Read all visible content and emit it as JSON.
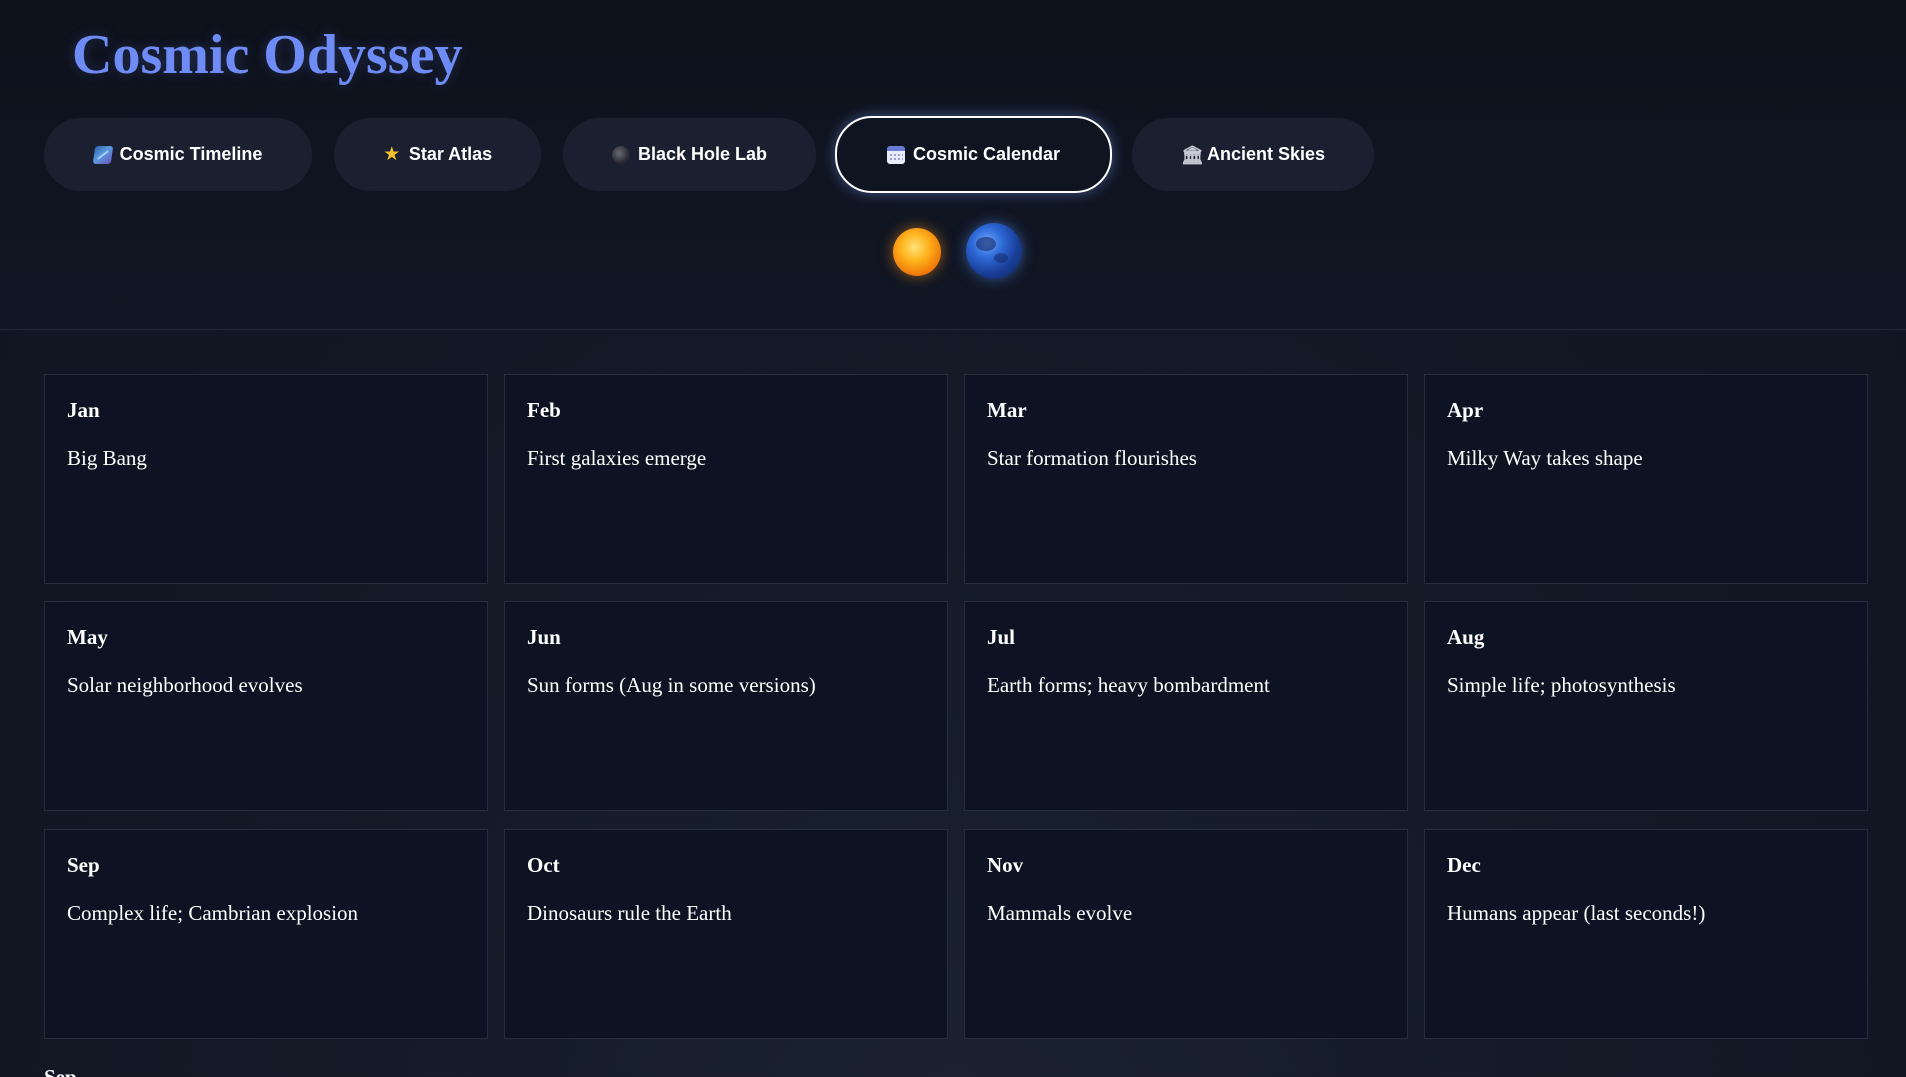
{
  "app": {
    "title": "Cosmic Odyssey"
  },
  "tabs": [
    {
      "label": "Cosmic Timeline",
      "icon": "timeline-icon"
    },
    {
      "label": "Star Atlas",
      "icon": "star-icon"
    },
    {
      "label": "Black Hole Lab",
      "icon": "black-hole-icon"
    },
    {
      "label": "Cosmic Calendar",
      "icon": "calendar-icon",
      "active": true
    },
    {
      "label": "Ancient Skies",
      "icon": "temple-icon"
    }
  ],
  "theme_toggles": [
    {
      "icon": "sun-icon"
    },
    {
      "icon": "earth-icon"
    }
  ],
  "calendar": {
    "months": [
      {
        "month": "Jan",
        "event": "Big Bang"
      },
      {
        "month": "Feb",
        "event": "First galaxies emerge"
      },
      {
        "month": "Mar",
        "event": "Star formation flourishes"
      },
      {
        "month": "Apr",
        "event": "Milky Way takes shape"
      },
      {
        "month": "May",
        "event": "Solar neighborhood evolves"
      },
      {
        "month": "Jun",
        "event": "Sun forms (Aug in some versions)"
      },
      {
        "month": "Jul",
        "event": "Earth forms; heavy bombardment"
      },
      {
        "month": "Aug",
        "event": "Simple life; photosynthesis"
      },
      {
        "month": "Sep",
        "event": "Complex life; Cambrian explosion"
      },
      {
        "month": "Oct",
        "event": "Dinosaurs rule the Earth"
      },
      {
        "month": "Nov",
        "event": "Mammals evolve"
      },
      {
        "month": "Dec",
        "event": "Humans appear (last seconds!)"
      }
    ],
    "footer_label": "Sep"
  },
  "colors": {
    "title": "#6f8cf6",
    "background": "#141a27",
    "card": "#0d1322",
    "tab": "#1a2030"
  }
}
